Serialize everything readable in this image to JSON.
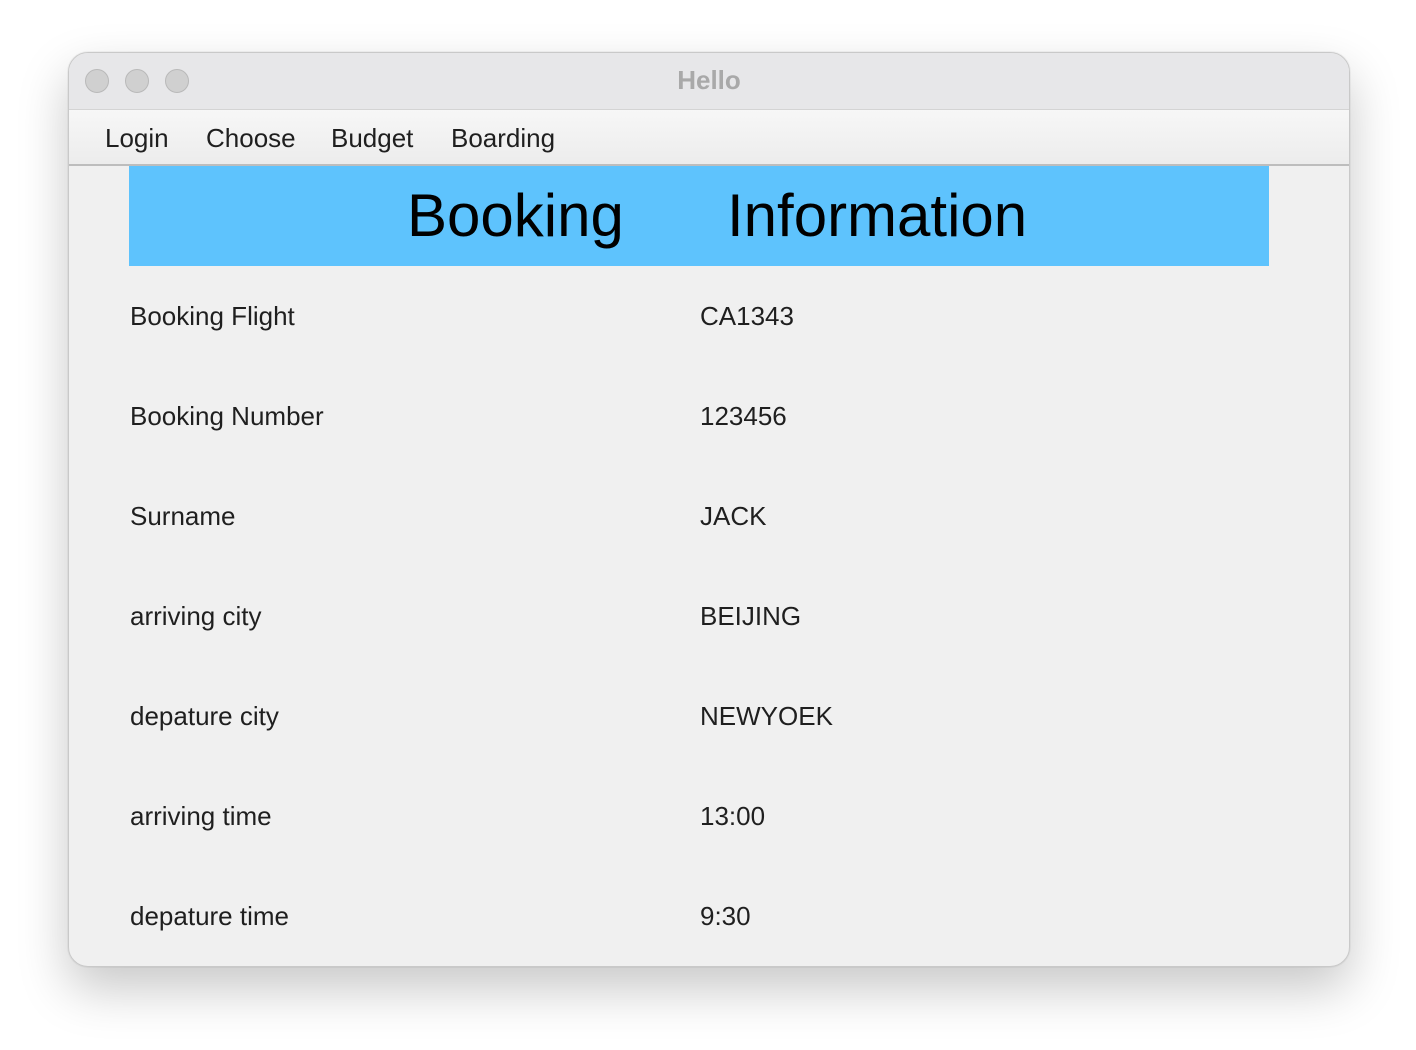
{
  "window": {
    "title": "Hello"
  },
  "menubar": {
    "items": [
      {
        "label": "Login"
      },
      {
        "label": "Choose"
      },
      {
        "label": "Budget"
      },
      {
        "label": "Boarding"
      }
    ]
  },
  "header": {
    "word1": "Booking",
    "word2": "Information",
    "background_color": "#5ec3fd"
  },
  "rows": [
    {
      "label": "Booking Flight",
      "value": "CA1343"
    },
    {
      "label": "Booking Number",
      "value": "123456"
    },
    {
      "label": "Surname",
      "value": "JACK"
    },
    {
      "label": "arriving city",
      "value": "BEIJING"
    },
    {
      "label": "depature city",
      "value": "NEWYOEK"
    },
    {
      "label": "arriving time",
      "value": "13:00"
    },
    {
      "label": "depature time",
      "value": "9:30"
    }
  ]
}
